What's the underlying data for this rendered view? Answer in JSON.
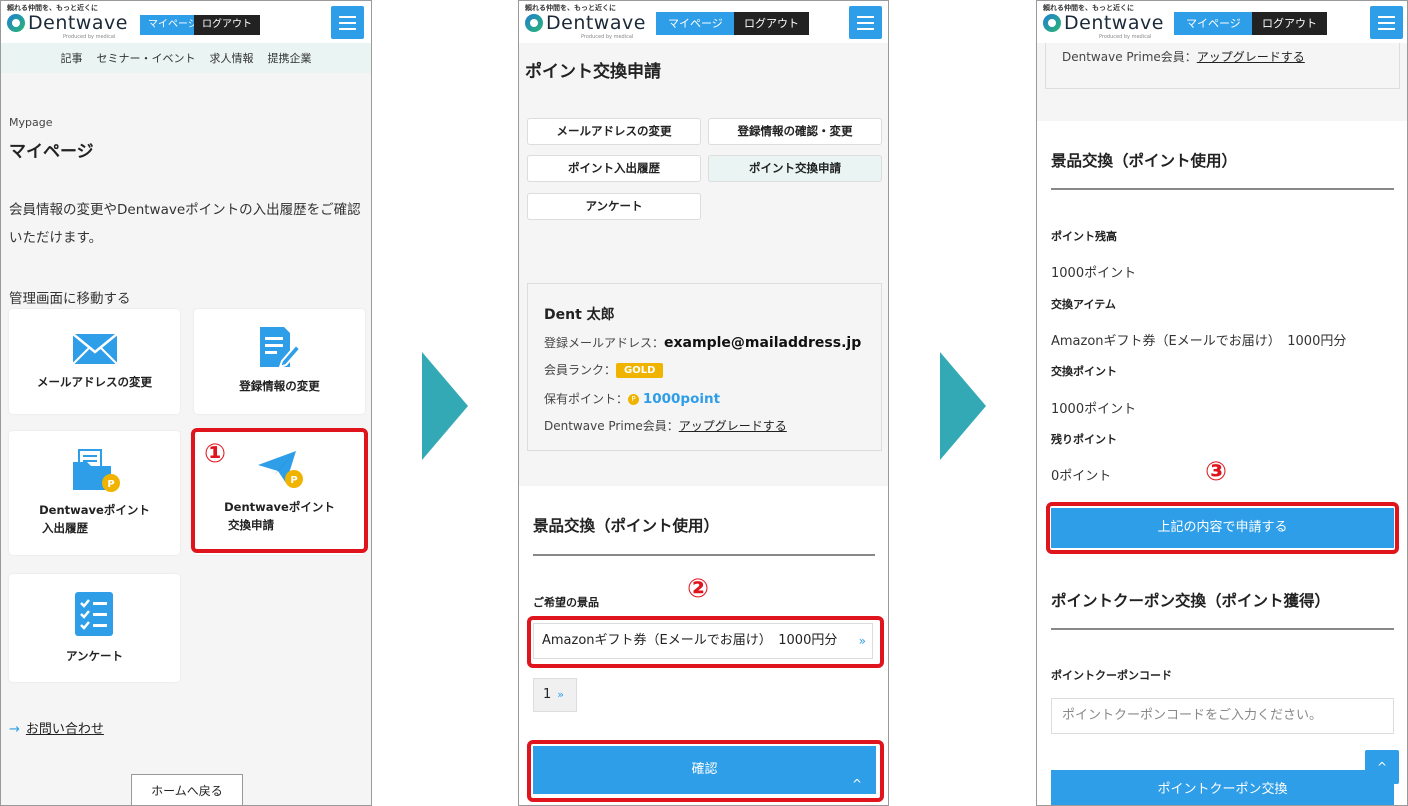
{
  "header": {
    "tagline": "頼れる仲間を、もっと近くに",
    "logo_text": "Dentwave",
    "logo_sub": "Produced by medical",
    "mypage_btn": "マイページ",
    "logout_btn": "ログアウト"
  },
  "screen1": {
    "nav": [
      "記事",
      "セミナー・イベント",
      "求人情報",
      "提携企業"
    ],
    "sub_title": "Mypage",
    "title": "マイページ",
    "description": "会員情報の変更やDentwaveポイントの入出履歴をご確認いただけます。",
    "mgmt_label": "管理画面に移動する",
    "cards": {
      "mail": "メールアドレスの変更",
      "reg": "登録情報の変更",
      "history_line1": "Dentwaveポイント",
      "history_line2": "入出履歴",
      "exchange_line1": "Dentwaveポイント",
      "exchange_line2": "交換申請",
      "survey": "アンケート"
    },
    "contact": "お問い合わせ",
    "home_btn": "ホームへ戻る",
    "step": "①"
  },
  "screen2": {
    "title": "ポイント交換申請",
    "tabs": {
      "mail": "メールアドレスの変更",
      "reg": "登録情報の確認・変更",
      "history": "ポイント入出履歴",
      "exchange": "ポイント交換申請",
      "survey": "アンケート"
    },
    "user": {
      "name": "Dent 太郎",
      "email_label": "登録メールアドレス：",
      "email": "example@mailaddress.jp",
      "rank_label": "会員ランク：",
      "rank": "GOLD",
      "points_label": "保有ポイント：",
      "coin": "P",
      "points": "1000point",
      "prime_label": "Dentwave Prime会員：",
      "prime_link": "アップグレードする"
    },
    "section_title": "景品交換（ポイント使用）",
    "prize_label": "ご希望の景品",
    "prize_value": "Amazonギフト券（Eメールでお届け）　1000円分",
    "chevron": "»",
    "qty": "1",
    "confirm_btn": "確認",
    "caret": "^",
    "step": "②"
  },
  "screen3": {
    "prime_label": "Dentwave Prime会員：",
    "prime_link": "アップグレードする",
    "section_title": "景品交換（ポイント使用）",
    "balance_label": "ポイント残高",
    "balance_value": "1000ポイント",
    "item_label": "交換アイテム",
    "item_value": "Amazonギフト券（Eメールでお届け）　1000円分",
    "exch_label": "交換ポイント",
    "exch_value": "1000ポイント",
    "remain_label": "残りポイント",
    "remain_value": "0ポイント",
    "apply_btn": "上記の内容で申請する",
    "coupon_title": "ポイントクーポン交換（ポイント獲得）",
    "coupon_label": "ポイントクーポンコード",
    "coupon_placeholder": "ポイントクーポンコードをご入力ください。",
    "coupon_btn": "ポイントクーポン交換",
    "totop": "^",
    "step": "③"
  },
  "colors": {
    "accent": "#2f9ee8",
    "highlight": "#e0141c",
    "arrow": "#33a9b5",
    "gold": "#f0b400"
  }
}
